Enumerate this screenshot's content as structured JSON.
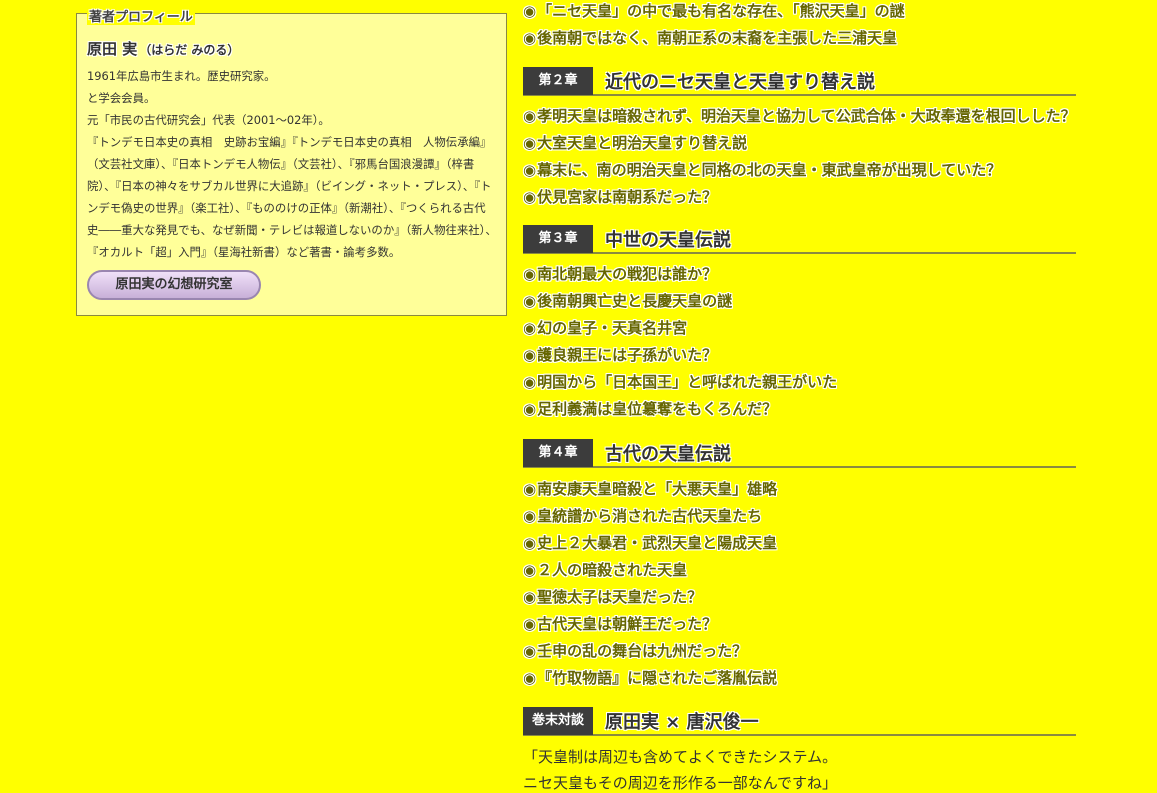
{
  "profile": {
    "legend": "著者プロフィール",
    "name": "原田 実",
    "reading": "（はらだ みのる）",
    "lines": [
      "1961年広島市生まれ。歴史研究家。",
      "と学会会員。",
      "元「市民の古代研究会」代表（2001～02年）。",
      "『トンデモ日本史の真相　史跡お宝編』『トンデモ日本史の真相　人物伝承編』（文芸社文庫）、『日本トンデモ人物伝』（文芸社）、『邪馬台国浪漫譚』（梓書院）、『日本の神々をサブカル世界に大追跡』（ビイング・ネット・プレス）、『トンデモ偽史の世界』（楽工社）、『もののけの正体』（新潮社）、『つくられる古代史――重大な発見でも、なぜ新聞・テレビは報道しないのか』（新人物往来社）、『オカルト「超」入門』（星海社新書）など著書・論考多数。"
    ],
    "lab_button": "原田実の幻想研究室"
  },
  "toc": {
    "bullet": "◉",
    "top_items": [
      "「ニセ天皇」の中で最も有名な存在、「熊沢天皇」の謎",
      "後南朝ではなく、南朝正系の末裔を主張した三浦天皇"
    ],
    "chapters": [
      {
        "badge": "第２章",
        "title": "近代のニセ天皇と天皇すり替え説",
        "items": [
          "孝明天皇は暗殺されず、明治天皇と協力して公武合体・大政奉還を根回しした？",
          "大室天皇と明治天皇すり替え説",
          "幕末に、南の明治天皇と同格の北の天皇・東武皇帝が出現していた？",
          "伏見宮家は南朝系だった？"
        ]
      },
      {
        "badge": "第３章",
        "title": "中世の天皇伝説",
        "items": [
          "南北朝最大の戦犯は誰か？",
          "後南朝興亡史と長慶天皇の謎",
          "幻の皇子・天真名井宮",
          "護良親王には子孫がいた？",
          "明国から「日本国王」と呼ばれた親王がいた",
          "足利義満は皇位簒奪をもくろんだ？"
        ]
      },
      {
        "badge": "第４章",
        "title": "古代の天皇伝説",
        "items": [
          "南安康天皇暗殺と「大悪天皇」雄略",
          "皇統譜から消された古代天皇たち",
          "史上２大暴君・武烈天皇と陽成天皇",
          "２人の暗殺された天皇",
          "聖徳太子は天皇だった？",
          "古代天皇は朝鮮王だった？",
          "壬申の乱の舞台は九州だった？",
          "『竹取物語』に隠されたご落胤伝説"
        ]
      }
    ],
    "talk": {
      "badge": "巻末対談",
      "title": "原田実 × 唐沢俊一",
      "lines": [
        "「天皇制は周辺も含めてよくできたシステム。",
        "ニセ天皇もその周辺を形作る一部なんですね」"
      ]
    }
  }
}
